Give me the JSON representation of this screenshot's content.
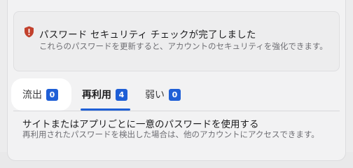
{
  "alert": {
    "icon": "shield-warning-icon",
    "title": "パスワード セキュリティ チェックが完了しました",
    "description": "これらのパスワードを更新すると、アカウントのセキュリティを強化できます。"
  },
  "tabs": [
    {
      "label": "流出",
      "count": "0"
    },
    {
      "label": "再利用",
      "count": "4"
    },
    {
      "label": "弱い",
      "count": "0"
    }
  ],
  "section": {
    "title": "サイトまたはアプリごとに一意のパスワードを使用する",
    "description": "再利用されたパスワードを検出した場合は、他のアカウントにアクセスできます。"
  },
  "colors": {
    "accent": "#1f5fd6",
    "warning": "#c2412d"
  }
}
